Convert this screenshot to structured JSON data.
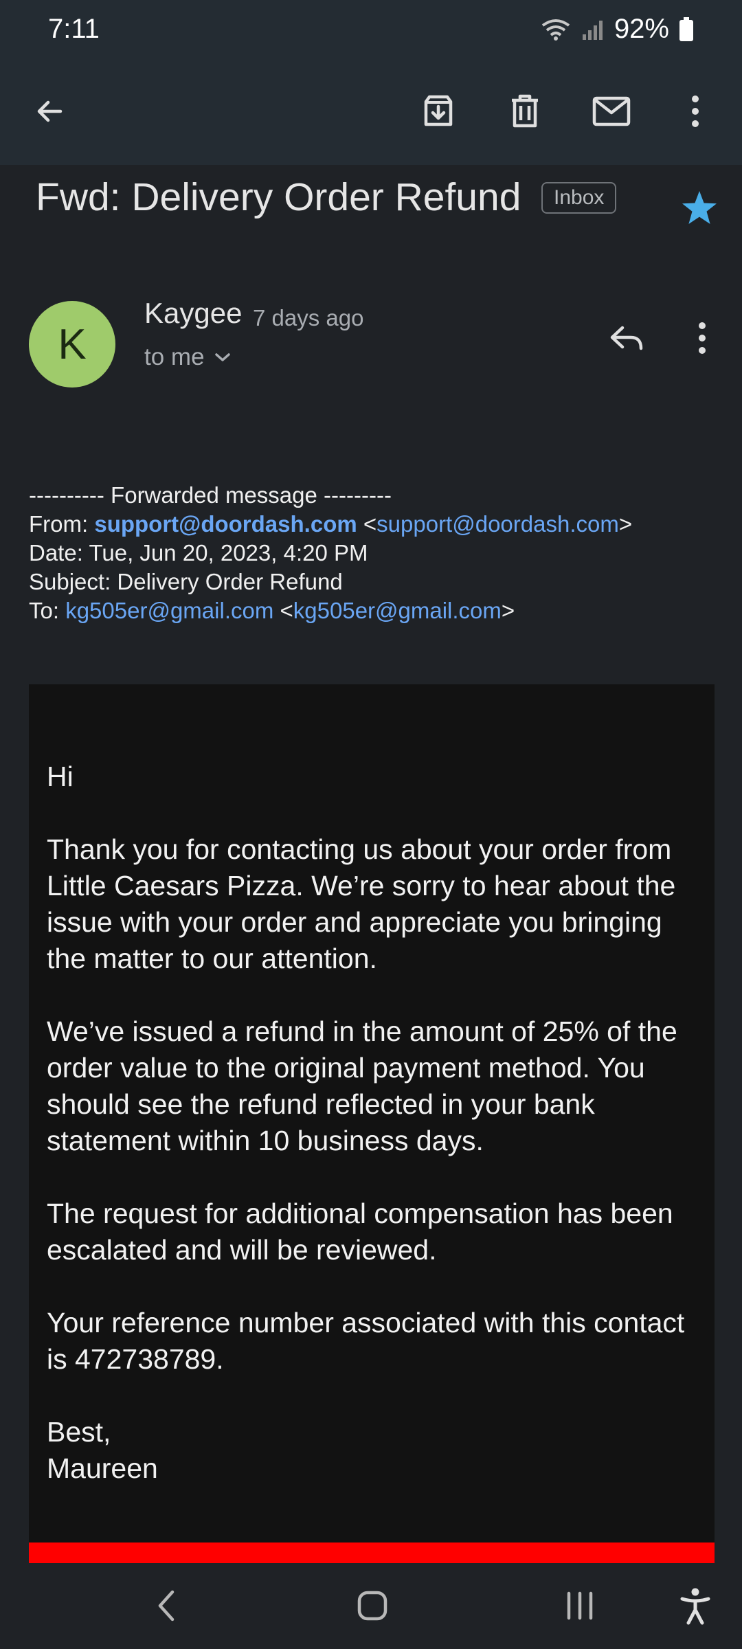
{
  "status_bar": {
    "time": "7:11",
    "battery": "92%"
  },
  "toolbar": {
    "icons": [
      "back-arrow-icon",
      "archive-icon",
      "delete-icon",
      "mark-unread-icon",
      "more-vert-icon"
    ]
  },
  "email": {
    "subject": "Fwd: Delivery Order Refund",
    "label": "Inbox",
    "starred": true,
    "star_color": "#4aaee8",
    "sender": {
      "initial": "K",
      "name": "Kaygee",
      "time": "7 days ago",
      "recipient": "to me",
      "avatar_color": "#9fcb6b"
    },
    "forwarded": {
      "divider": "---------- Forwarded message ---------",
      "from_label": "From:",
      "from_name": "support@doordash.com",
      "from_email": "support@doordash.com",
      "date_line": "Date: Tue, Jun 20, 2023, 4:20 PM",
      "subject_line": "Subject: Delivery Order Refund",
      "to_label": "To:",
      "to_name": "kg505er@gmail.com",
      "to_email": "kg505er@gmail.com"
    },
    "body": {
      "greeting": "Hi",
      "p1": "Thank you for contacting us about your order from Little Caesars Pizza.  We’re sorry to hear about the issue with your order and appreciate you bringing the matter to our attention.",
      "p2": "We’ve issued a refund in the amount of 25% of the order value to the original payment method. You should see the refund reflected in your bank statement within 10 business days.",
      "p3": "The request for additional compensation has been escalated and will be reviewed.",
      "p4": "Your reference number associated with this contact is 472738789.",
      "signoff": "Best,",
      "signature": "Maureen"
    },
    "accent_color": "#ff0000",
    "link_color": "#6aa6f4"
  },
  "nav": {
    "icons": [
      "nav-back-icon",
      "nav-home-icon",
      "nav-recents-icon",
      "accessibility-icon"
    ]
  }
}
